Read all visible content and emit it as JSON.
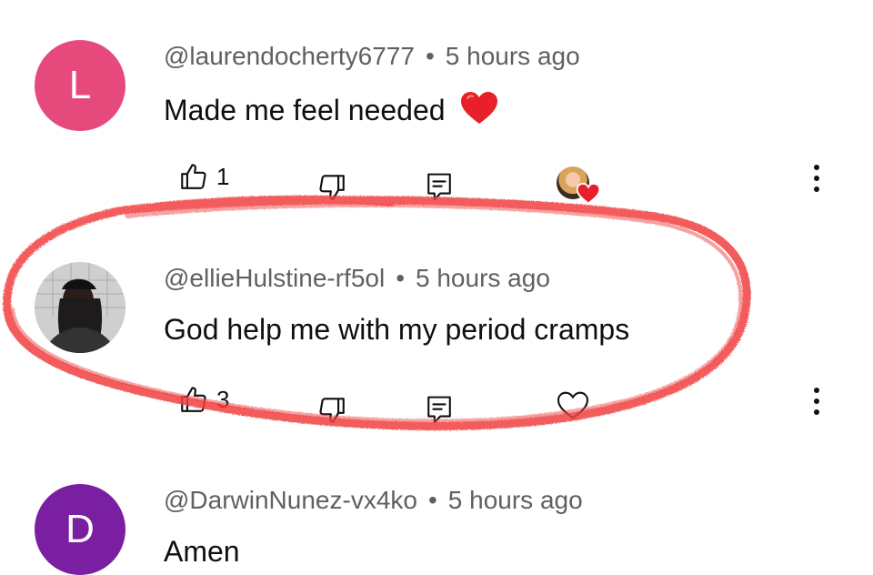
{
  "comments": [
    {
      "avatar_letter": "L",
      "avatar_color": "#e64a7c",
      "author": "@laurendocherty6777",
      "time": "5 hours ago",
      "text": "Made me feel needed",
      "emoji": "❤️",
      "likes": "1",
      "creator_heart": true
    },
    {
      "avatar_letter": "",
      "avatar_color": "#6b6b6b",
      "author": "@ellieHulstine-rf5ol",
      "time": "5 hours ago",
      "text": "God help me with my period cramps",
      "likes": "3",
      "creator_heart": false
    },
    {
      "avatar_letter": "D",
      "avatar_color": "#7b1fa2",
      "author": "@DarwinNunez-vx4ko",
      "time": "5 hours ago",
      "text": "Amen"
    }
  ],
  "separator": "•",
  "annotation_color": "#f04040"
}
